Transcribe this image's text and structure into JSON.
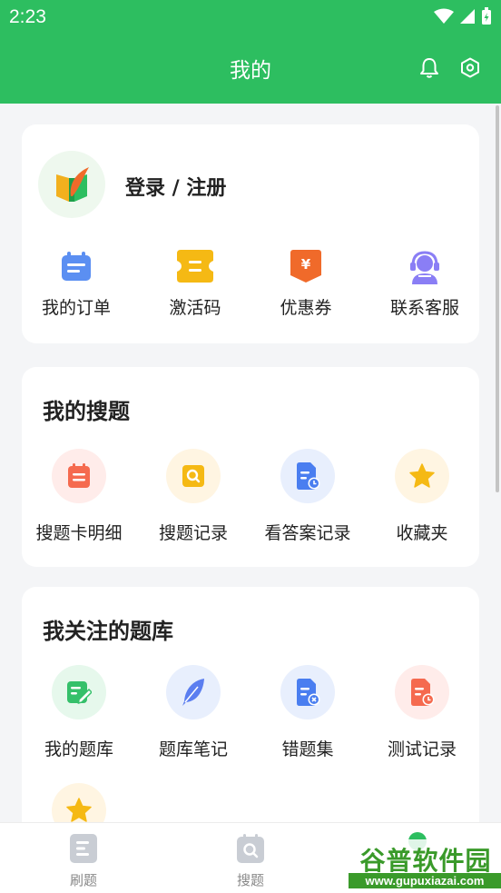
{
  "status": {
    "time": "2:23"
  },
  "appbar": {
    "title": "我的",
    "bell_icon": "bell-icon",
    "settings_icon": "gear-icon"
  },
  "colors": {
    "primary": "#2dbe60",
    "background": "#f4f5f7"
  },
  "profile": {
    "login_label": "登录 / 注册"
  },
  "quick": [
    {
      "label": "我的订单",
      "icon": "order-icon",
      "color": "#5b8ff2"
    },
    {
      "label": "激活码",
      "icon": "ticket-icon",
      "color": "#f5b914"
    },
    {
      "label": "优惠券",
      "icon": "coupon-icon",
      "color": "#f06a2a"
    },
    {
      "label": "联系客服",
      "icon": "headset-icon",
      "color": "#8a7ef5"
    }
  ],
  "search_section": {
    "title": "我的搜题",
    "items": [
      {
        "label": "搜题卡明细",
        "icon": "search-card-icon",
        "color": "#f56a4f",
        "bg": "#ffecea"
      },
      {
        "label": "搜题记录",
        "icon": "search-record-icon",
        "color": "#f5b914",
        "bg": "#fff5e2"
      },
      {
        "label": "看答案记录",
        "icon": "answer-record-icon",
        "color": "#4a7ef0",
        "bg": "#e8effd"
      },
      {
        "label": "收藏夹",
        "icon": "star-icon",
        "color": "#f5b914",
        "bg": "#fff5e2"
      }
    ]
  },
  "bank_section": {
    "title": "我关注的题库",
    "items": [
      {
        "label": "我的题库",
        "icon": "bank-edit-icon",
        "color": "#35c06a",
        "bg": "#e6f8ec"
      },
      {
        "label": "题库笔记",
        "icon": "feather-icon",
        "color": "#5b7ef0",
        "bg": "#e8effd"
      },
      {
        "label": "错题集",
        "icon": "wrong-doc-icon",
        "color": "#4a7ef0",
        "bg": "#e8effd"
      },
      {
        "label": "测试记录",
        "icon": "test-record-icon",
        "color": "#f56a4f",
        "bg": "#ffecea"
      }
    ],
    "extra_icon": "star-icon"
  },
  "bottom_nav": [
    {
      "label": "刷题",
      "icon": "practice-icon"
    },
    {
      "label": "搜题",
      "icon": "search-tab-icon"
    }
  ],
  "watermark": {
    "line1": "谷普软件园",
    "line2": "www.gupuxiazai.com"
  }
}
